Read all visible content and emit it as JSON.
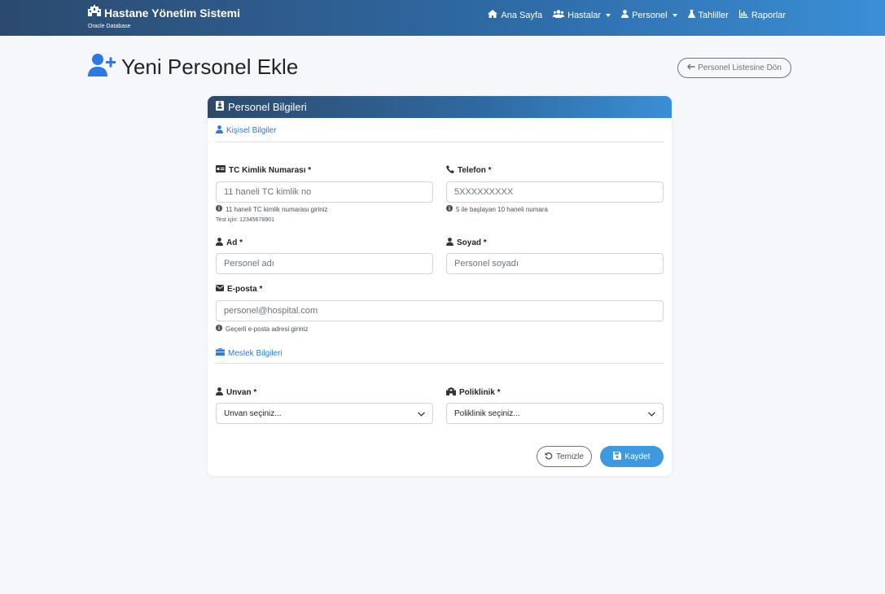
{
  "navbar": {
    "brand_title": "Hastane Yönetim Sistemi",
    "brand_subtitle": "Oracle Database",
    "links": {
      "home": "Ana Sayfa",
      "patients": "Hastalar",
      "staff": "Personel",
      "tests": "Tahliller",
      "reports": "Raporlar"
    }
  },
  "page": {
    "title": "Yeni Personel Ekle",
    "back_button": "Personel Listesine Dön"
  },
  "card": {
    "title": "Personel Bilgileri",
    "personal_section": "Kişisel Bilgiler",
    "job_section": "Meslek Bilgileri"
  },
  "form": {
    "tc": {
      "label": "TC Kimlik Numarası *",
      "placeholder": "11 haneli TC kimlik no",
      "help": "11 haneli TC kimlik numarası giriniz",
      "help2": "Test için: 12345678901"
    },
    "phone": {
      "label": "Telefon *",
      "placeholder": "5XXXXXXXXX",
      "help": "5 ile başlayan 10 haneli numara"
    },
    "first_name": {
      "label": "Ad *",
      "placeholder": "Personel adı"
    },
    "last_name": {
      "label": "Soyad *",
      "placeholder": "Personel soyadı"
    },
    "email": {
      "label": "E-posta *",
      "placeholder": "personel@hospital.com",
      "help": "Geçerli e-posta adresi giriniz"
    },
    "title": {
      "label": "Unvan *",
      "selected": "Unvan seçiniz..."
    },
    "clinic": {
      "label": "Poliklinik *",
      "selected": "Poliklinik seçiniz..."
    }
  },
  "actions": {
    "clear": "Temizle",
    "save": "Kaydet"
  },
  "colors": {
    "accent": "#2a7ae2",
    "save_button": "#3d9ae0",
    "navbar_start": "#2c4a6e",
    "navbar_end": "#3a8fd6"
  }
}
